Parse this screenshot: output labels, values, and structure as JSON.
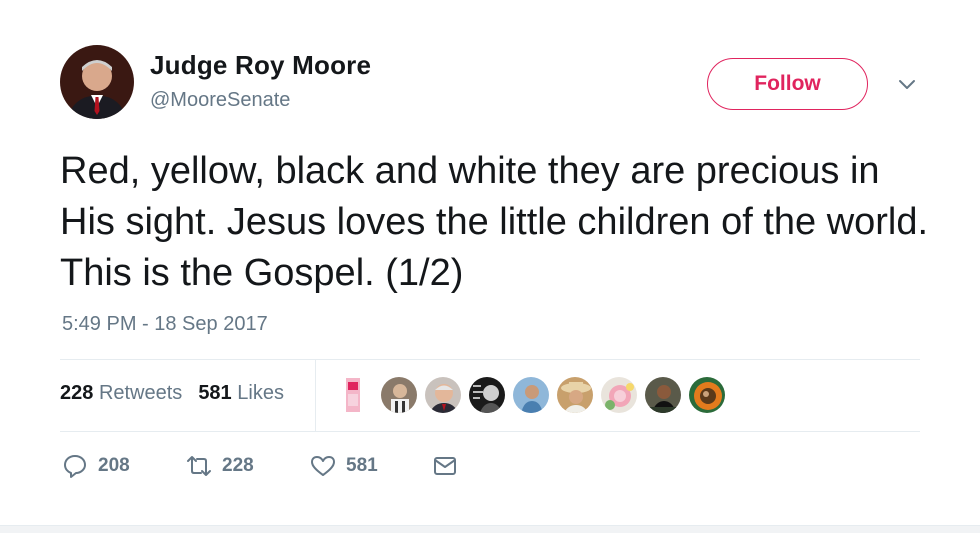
{
  "tweet": {
    "author_name": "Judge Roy Moore",
    "author_handle": "@MooreSenate",
    "follow_label": "Follow",
    "text": "Red, yellow, black and white they are precious in His sight. Jesus loves the little children of the world. This is the Gospel. (1/2)",
    "timestamp": "5:49 PM - 18 Sep 2017"
  },
  "stats": {
    "retweets_count": "228",
    "retweets_label": "Retweets",
    "likes_count": "581",
    "likes_label": "Likes"
  },
  "actions": {
    "reply_count": "208",
    "retweet_count": "228",
    "like_count": "581"
  },
  "icons": {
    "caret": "chevron-down-icon",
    "reply": "reply-icon",
    "retweet": "retweet-icon",
    "like": "heart-icon",
    "message": "envelope-icon"
  },
  "colors": {
    "follow_accent": "#e0245e",
    "secondary_text": "#657786",
    "primary_text": "#14171a"
  }
}
